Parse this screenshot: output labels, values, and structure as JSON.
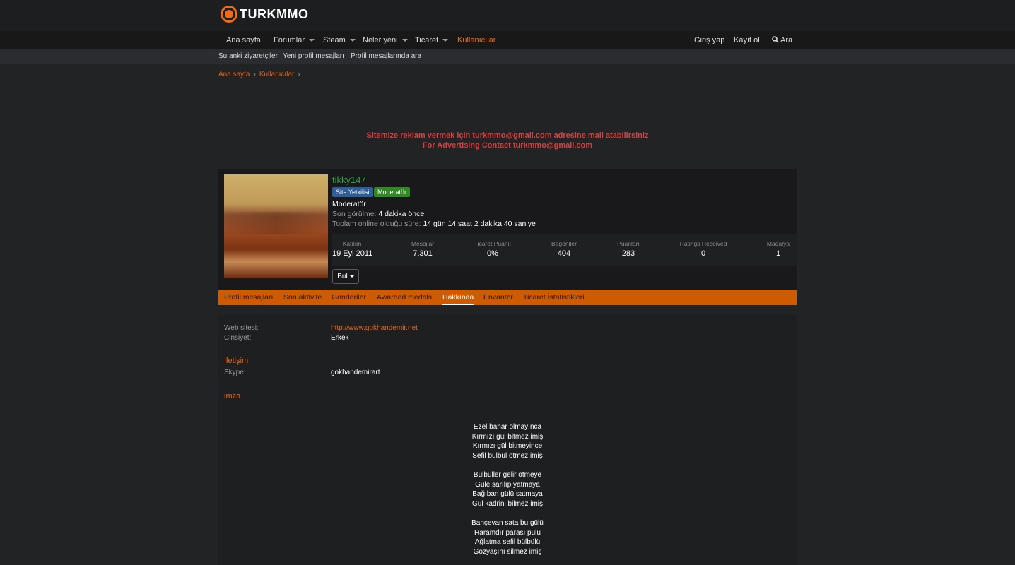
{
  "header": {
    "logo_text": "TURKMMO"
  },
  "nav": {
    "items": [
      {
        "label": "Ana sayfa"
      },
      {
        "label": "Forumlar"
      },
      {
        "label": "Steam"
      },
      {
        "label": "Neler yeni"
      },
      {
        "label": "Ticaret"
      },
      {
        "label": "Kullanıcılar"
      }
    ],
    "login": "Giriş yap",
    "register": "Kayıt ol",
    "search": "Ara"
  },
  "subnav": {
    "items": [
      {
        "label": "Şu anki ziyaretçiler"
      },
      {
        "label": "Yeni profil mesajları"
      },
      {
        "label": "Profil mesajlarında ara"
      }
    ]
  },
  "breadcrumb": {
    "items": [
      "Ana sayfa",
      "Kullanıcılar"
    ],
    "separator": "›"
  },
  "ad": {
    "line1": "Sitemize reklam vermek için turkmmo@gmail.com adresine mail atabilirsiniz",
    "line2": "For Advertising Contact turkmmo@gmail.com"
  },
  "profile": {
    "username": "tikky147",
    "badges": [
      "Site Yetkilisi",
      "Moderatör"
    ],
    "title": "Moderatör",
    "last_seen_label": "Son görülme:",
    "last_seen_value": "4 dakika önce",
    "online_label": "Toplam online olduğu süre:",
    "online_value": "14 gün 14 saat 2 dakika 40 saniye",
    "stats": [
      {
        "label": "Katılım",
        "value": "19 Eyl 2011"
      },
      {
        "label": "Mesajlar",
        "value": "7,301"
      },
      {
        "label": "Ticaret Puanı:",
        "value": "0%"
      },
      {
        "label": "Beğeniler",
        "value": "404"
      },
      {
        "label": "Puanları",
        "value": "283"
      },
      {
        "label": "Ratings Received",
        "value": "0"
      },
      {
        "label": "Madalya",
        "value": "1"
      }
    ],
    "find_button": "Bul"
  },
  "tabs": [
    {
      "label": "Profil mesajları"
    },
    {
      "label": "Son aktivite"
    },
    {
      "label": "Gönderiler"
    },
    {
      "label": "Awarded medals"
    },
    {
      "label": "Hakkında"
    },
    {
      "label": "Envanter"
    },
    {
      "label": "Ticaret İstatistikleri"
    }
  ],
  "about": {
    "website_label": "Web sitesi:",
    "website_value": "http://www.gokhandemir.net",
    "gender_label": "Cinsiyet:",
    "gender_value": "Erkek",
    "contact_heading": "İletişim",
    "skype_label": "Skype:",
    "skype_value": "gokhandemirart",
    "signature_heading": "imza",
    "signature_lines": [
      "Ezel bahar olmayınca",
      "Kırmızı gül bitmez imiş",
      "Kırmızı gül bitmeyince",
      "Sefil bülbül ötmez imiş",
      "",
      "Bülbüller gelir ötmeye",
      "Güle sarılıp yatmaya",
      "Bağıban gülü satmaya",
      "Gül kadrini bilmez imiş",
      "",
      "Bahçevan sata bu gülü",
      "Haramdır parası pulu",
      "Ağlatma sefil bülbülü",
      "Gözyaşını silmez imiş"
    ]
  },
  "colors": {
    "accent": "#e0651c",
    "tab_bar": "#cf5a00",
    "username": "#2fa044",
    "ad_text": "#e23b3b"
  }
}
